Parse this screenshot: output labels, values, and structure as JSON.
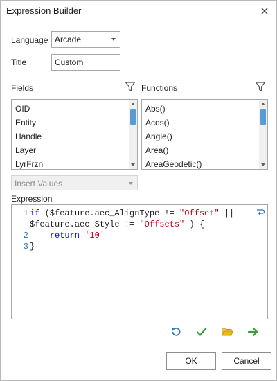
{
  "window": {
    "title": "Expression Builder",
    "close_glyph": "✕"
  },
  "language": {
    "label": "Language",
    "value": "Arcade"
  },
  "title_field": {
    "label": "Title",
    "value": "Custom"
  },
  "fields": {
    "label": "Fields",
    "items": [
      "OID",
      "Entity",
      "Handle",
      "Layer",
      "LyrFrzn"
    ]
  },
  "functions": {
    "label": "Functions",
    "items": [
      "Abs()",
      "Acos()",
      "Angle()",
      "Area()",
      "AreaGeodetic()"
    ]
  },
  "insert_values": {
    "value": "Insert Values"
  },
  "expression": {
    "label": "Expression",
    "lines": [
      {
        "number": "1",
        "parts": [
          {
            "t": "if",
            "c": "kw"
          },
          {
            "t": " ($feature.aec_AlignType != ",
            "c": "var"
          },
          {
            "t": "\"Offset\"",
            "c": "str"
          },
          {
            "t": " ||",
            "c": "op"
          }
        ]
      },
      {
        "number": "",
        "parts": [
          {
            "t": "$feature.aec_Style != ",
            "c": "var"
          },
          {
            "t": "\"Offsets\"",
            "c": "str"
          },
          {
            "t": " ) {",
            "c": "op"
          }
        ]
      },
      {
        "number": "2",
        "parts": [
          {
            "t": "    return ",
            "c": "kw"
          },
          {
            "t": "'10'",
            "c": "str"
          }
        ]
      },
      {
        "number": "3",
        "parts": [
          {
            "t": "}",
            "c": "op"
          }
        ]
      }
    ]
  },
  "toolbar_icons": [
    "undo-icon",
    "verify-checkmark-icon",
    "open-folder-icon",
    "run-arrow-icon"
  ],
  "buttons": {
    "ok": "OK",
    "cancel": "Cancel"
  },
  "colors": {
    "accent_blue": "#5b9bd5",
    "check_green": "#3c9a3c",
    "folder_yellow": "#e8b923",
    "string_red": "#c0001c",
    "keyword_blue": "#0000ff"
  }
}
